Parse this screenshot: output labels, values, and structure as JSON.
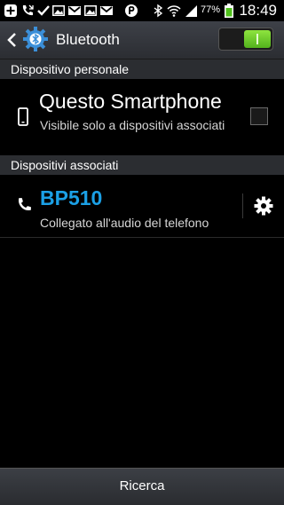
{
  "status_bar": {
    "battery_percent": "77%",
    "time": "18:49"
  },
  "action_bar": {
    "title": "Bluetooth",
    "toggle_on": true
  },
  "sections": {
    "personal": {
      "header": "Dispositivo personale",
      "device_name": "Questo Smartphone",
      "device_subtitle": "Visibile solo a dispositivi associati",
      "visible_checked": false
    },
    "paired": {
      "header": "Dispositivi associati",
      "device_name": "BP510",
      "device_status": "Collegato all'audio del telefono"
    }
  },
  "bottom": {
    "search_label": "Ricerca"
  },
  "colors": {
    "accent_blue": "#1ba0e6",
    "toggle_green": "#6cc62b",
    "battery_green": "#4fc11b"
  }
}
